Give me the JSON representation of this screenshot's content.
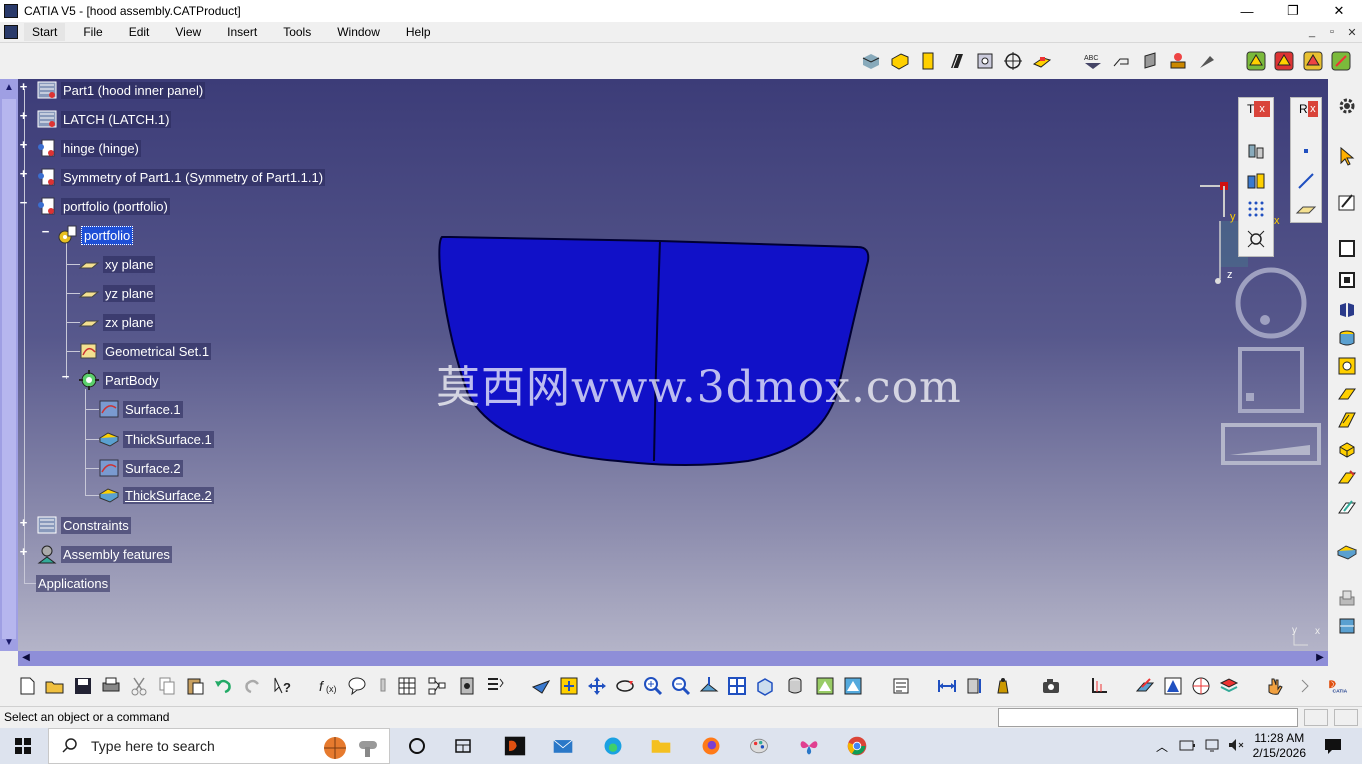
{
  "window": {
    "title": "CATIA V5 - [hood assembly.CATProduct]",
    "controls": [
      "—",
      "❐",
      "✕"
    ]
  },
  "menu": {
    "items": [
      "Start",
      "File",
      "Edit",
      "View",
      "Insert",
      "Tools",
      "Window",
      "Help"
    ],
    "active": "Start",
    "mdi_controls": [
      "_",
      "▫",
      "✕"
    ]
  },
  "tree": {
    "nodes": [
      {
        "label": "Part1 (hood inner panel)",
        "icon": "part-instance-icon"
      },
      {
        "label": "LATCH (LATCH.1)",
        "icon": "part-instance-icon"
      },
      {
        "label": "hinge (hinge)",
        "icon": "component-icon"
      },
      {
        "label": "Symmetry of Part1.1 (Symmetry of Part1.1.1)",
        "icon": "component-icon"
      },
      {
        "label": "portfolio (portfolio)",
        "icon": "component-icon"
      },
      {
        "label": "portfolio",
        "icon": "part-gear-icon"
      },
      {
        "label": "xy plane",
        "icon": "plane-icon"
      },
      {
        "label": "yz plane",
        "icon": "plane-icon"
      },
      {
        "label": "zx plane",
        "icon": "plane-icon"
      },
      {
        "label": "Geometrical Set.1",
        "icon": "geometrical-set-icon"
      },
      {
        "label": "PartBody",
        "icon": "partbody-icon"
      },
      {
        "label": "Surface.1",
        "icon": "surface-icon"
      },
      {
        "label": "ThickSurface.1",
        "icon": "thicksurface-icon"
      },
      {
        "label": "Surface.2",
        "icon": "surface-icon"
      },
      {
        "label": "ThickSurface.2",
        "icon": "thicksurface-icon"
      },
      {
        "label": "Constraints",
        "icon": "constraints-icon"
      },
      {
        "label": "Assembly features",
        "icon": "assembly-features-icon"
      },
      {
        "label": "Applications",
        "icon": ""
      }
    ],
    "selected": "portfolio"
  },
  "viewport": {
    "watermark": "莫西网www.3dmox.com",
    "part_color": "#1111c8",
    "background_top": "#3c3c78",
    "background_bottom": "#b4b4c8"
  },
  "panels": {
    "tools_title": "T",
    "reference_title": "R",
    "close": "x"
  },
  "compass": {
    "axis_y": "y",
    "axis_x": "x",
    "axis_z": "z"
  },
  "mini_axis": {
    "y": "y",
    "x": "x"
  },
  "status": {
    "message": "Select an object or a command",
    "command_value": ""
  },
  "taskbar": {
    "search_placeholder": "Type here to search",
    "time": "11:28 AM",
    "date": "2/15/2026"
  }
}
